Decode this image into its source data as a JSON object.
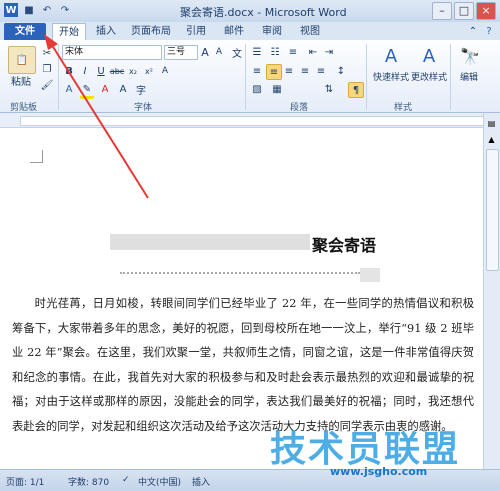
{
  "window": {
    "title": "聚会寄语.docx - Microsoft Word"
  },
  "tabs": [
    "文件",
    "开始",
    "插入",
    "页面布局",
    "引用",
    "邮件",
    "审阅",
    "视图"
  ],
  "ribbon": {
    "paste_label": "粘贴",
    "font_name": "宋体",
    "font_size": "三号",
    "styles_quick": "快速样式",
    "styles_change": "更改样式",
    "edit_label": "编辑",
    "groups": {
      "clipboard": "剪贴板",
      "font": "字体",
      "paragraph": "段落",
      "styles": "样式"
    }
  },
  "document": {
    "title": "聚会寄语",
    "body": "时光荏苒，日月如梭，转眼间同学们已经毕业了 22 年，在一些同学的热情倡议和积极筹备下，大家带着多年的思念，美好的祝愿，回到母校所在地一一汶上，举行“91 级 2 班毕业 22 年”聚会。在这里，我们欢聚一堂，共叙师生之情，同窗之谊，这是一件非常值得庆贺和纪念的事情。在此，我首先对大家的积极参与和及时赴会表示最热烈的欢迎和最诚挚的祝福；对由于这样或那样的原因，没能赴会的同学，表达我们最美好的祝福；同时，我还想代表赴会的同学，对发起和组织这次活动及给予这次活动大力支持的同学表示由衷的感谢。"
  },
  "status": {
    "page": "页面: 1/1",
    "words": "字数: 870",
    "language": "中文(中国)",
    "mode": "插入"
  },
  "watermark": {
    "text": "技术员联盟",
    "url": "www.jsgho.com"
  }
}
